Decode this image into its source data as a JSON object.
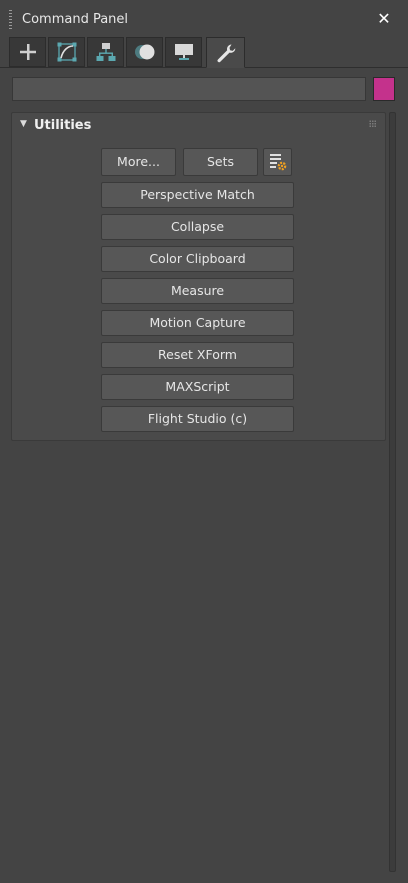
{
  "window": {
    "title": "Command Panel",
    "close_symbol": "✕"
  },
  "tabs": [
    {
      "name": "Create",
      "icon": "plus-icon"
    },
    {
      "name": "Modify",
      "icon": "modify-curve-icon"
    },
    {
      "name": "Hierarchy",
      "icon": "hierarchy-icon"
    },
    {
      "name": "Motion",
      "icon": "motion-circles-icon"
    },
    {
      "name": "Display",
      "icon": "display-monitor-icon"
    },
    {
      "name": "Utilities",
      "icon": "wrench-icon",
      "active": true
    }
  ],
  "name_field": {
    "value": "",
    "color": "#c4328c"
  },
  "rollout": {
    "title": "Utilities",
    "expand_symbol": "▼",
    "more_label": "More...",
    "sets_label": "Sets",
    "config_icon": "configure-sets-icon",
    "buttons": [
      "Perspective Match",
      "Collapse",
      "Color Clipboard",
      "Measure",
      "Motion Capture",
      "Reset XForm",
      "MAXScript",
      "Flight Studio (c)"
    ]
  },
  "colors": {
    "accent_teal": "#5ba8b0",
    "swatch_magenta": "#c4328c",
    "gear_orange": "#f0a020"
  }
}
